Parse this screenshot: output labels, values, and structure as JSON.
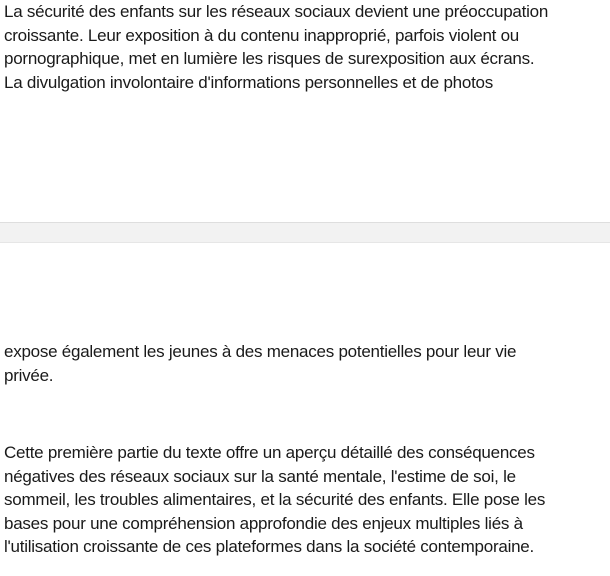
{
  "document": {
    "page1_lines": [
      "La sécurité des enfants sur les réseaux sociaux devient une préoccupation",
      "croissante. Leur exposition à du contenu inapproprié, parfois violent ou",
      "pornographique, met en lumière les risques de surexposition aux écrans.",
      "La divulgation involontaire d'informations personnelles et de photos"
    ],
    "page2_para1_lines": [
      "expose également les jeunes à des menaces potentielles pour leur vie",
      "privée."
    ],
    "page2_para2_lines": [
      "Cette première partie du texte offre un aperçu détaillé des conséquences",
      "négatives des réseaux sociaux sur la santé mentale, l'estime de soi, le",
      "sommeil, les troubles alimentaires, et la sécurité des enfants. Elle pose les",
      "bases pour une compréhension approfondie des enjeux multiples liés à",
      "l'utilisation croissante de ces plateformes dans la société contemporaine."
    ]
  }
}
